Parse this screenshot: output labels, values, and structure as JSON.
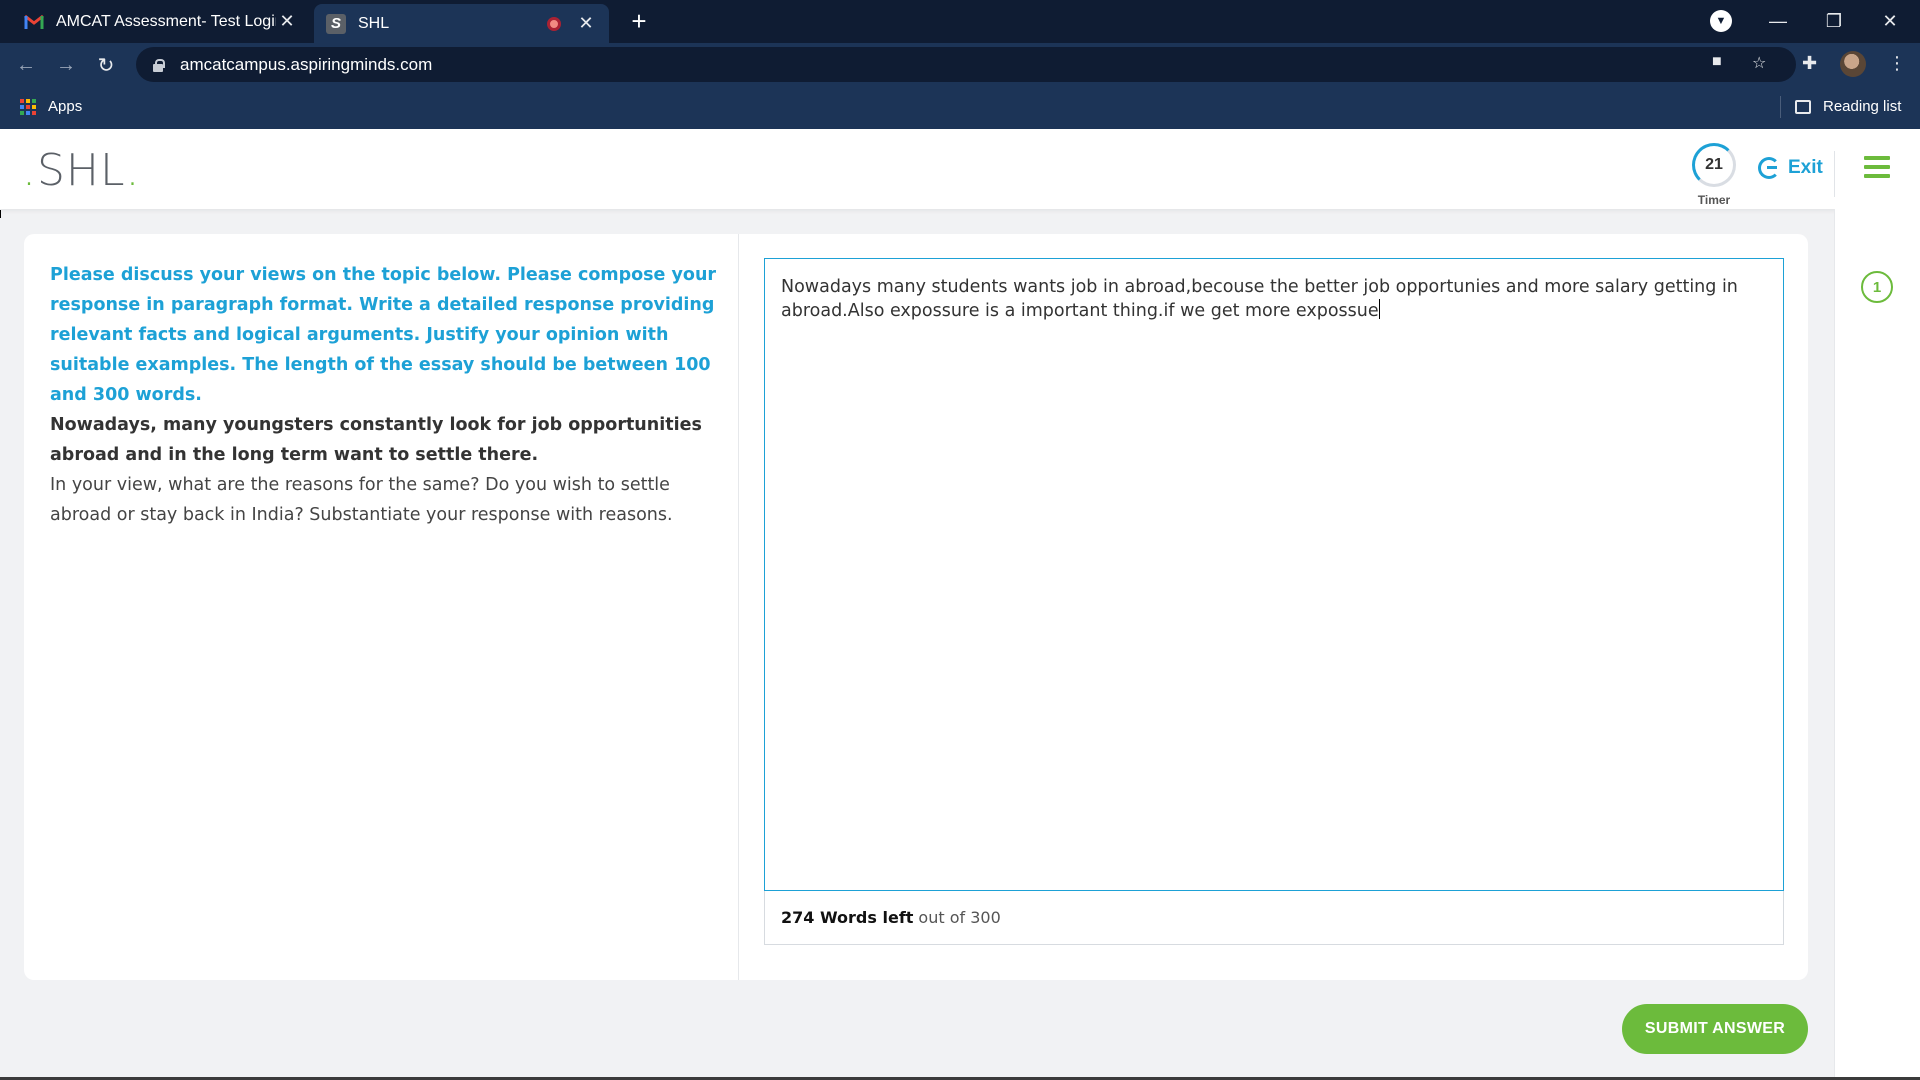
{
  "browser": {
    "tabs": [
      {
        "title": "AMCAT Assessment- Test Login I",
        "favicon": "gmail-icon"
      },
      {
        "title": "SHL",
        "favicon": "shl-icon",
        "active": true
      }
    ],
    "url": "amcatcampus.aspiringminds.com",
    "bookmarks": {
      "apps_label": "Apps",
      "reading_list_label": "Reading list"
    }
  },
  "header": {
    "logo_text": ".SHL.",
    "timer_value": "21",
    "timer_label": "Timer",
    "exit_label": "Exit"
  },
  "question": {
    "instructions": "Please discuss your views on the topic below. Please compose your response in paragraph format. Write a detailed response providing relevant facts and logical arguments. Justify your opinion with suitable examples. The length of the essay should be between 100 and 300 words.",
    "topic": "Nowadays, many youngsters constantly look for job opportunities abroad and in the long term want to settle there.",
    "prompt": "In your view, what are the reasons for the same? Do you wish to settle abroad or stay back in India? Substantiate your response with reasons."
  },
  "answer": {
    "text": "Nowadays many students wants job in abroad,becouse the better job opportunies and more salary getting in abroad.Also expossure is a important thing.if we get more expossue",
    "words_left": "274 Words left",
    "out_of": "out of 300"
  },
  "sidebar": {
    "question_number": "1"
  },
  "actions": {
    "submit_label": "SUBMIT ANSWER"
  },
  "colors": {
    "accent_blue": "#1da1d6",
    "accent_green": "#6cbb3c",
    "chrome_dark": "#0f1c33",
    "chrome_mid": "#1c3457"
  }
}
